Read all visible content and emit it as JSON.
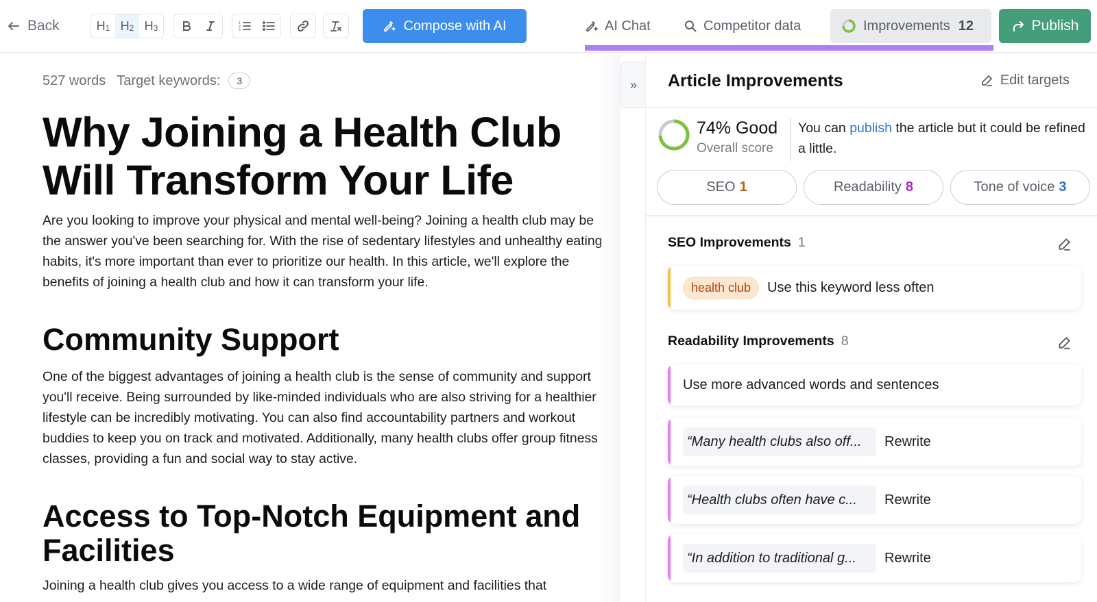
{
  "toolbar": {
    "back_label": "Back",
    "heading_buttons": [
      {
        "label": "H",
        "sub": "1",
        "active": false
      },
      {
        "label": "H",
        "sub": "2",
        "active": true
      },
      {
        "label": "H",
        "sub": "3",
        "active": false
      }
    ],
    "format_buttons": [
      "bold-icon",
      "italic-icon"
    ],
    "list_buttons": [
      "ordered-list-icon",
      "bullet-list-icon"
    ],
    "link_button": "link-icon",
    "clear_format_button": "clear-format-icon",
    "compose_label": "Compose with AI",
    "compose_color": "#3d8def"
  },
  "tabs": {
    "ai_chat": "AI Chat",
    "competitor": "Competitor data",
    "improvements": "Improvements",
    "improvements_count": "12",
    "active_underline_color": "#b07ef2"
  },
  "publish": {
    "label": "Publish",
    "color": "#449e79"
  },
  "editor": {
    "word_count": "527 words",
    "target_keywords_label": "Target keywords:",
    "target_keywords_count": "3",
    "title": "Why Joining a Health Club Will Transform Your Life",
    "intro": "Are you looking to improve your physical and mental well-being? Joining a health club may be the answer you've been searching for. With the rise of sedentary lifestyles and unhealthy eating habits, it's more important than ever to prioritize our health. In this article, we'll explore the benefits of joining a health club and how it can transform your life.",
    "sections": [
      {
        "heading": "Community Support",
        "body": "One of the biggest advantages of joining a health club is the sense of community and support you'll receive. Being surrounded by like-minded individuals who are also striving for a healthier lifestyle can be incredibly motivating. You can also find accountability partners and workout buddies to keep you on track and motivated. Additionally, many health clubs offer group fitness classes, providing a fun and social way to stay active."
      },
      {
        "heading": "Access to Top-Notch Equipment and Facilities",
        "body": "Joining a health club gives you access to a wide range of equipment and facilities that"
      }
    ]
  },
  "panel": {
    "collapse_glyph": "»",
    "title": "Article Improvements",
    "edit_targets_label": "Edit targets",
    "score": {
      "percent": 74,
      "percent_label": "74% Good",
      "label": "Overall score",
      "ring_color": "#7cc241",
      "ring_track_color": "#c9ccd3"
    },
    "message_before": "You can ",
    "message_link": "publish",
    "message_after": " the article but it could be refined a little.",
    "chips": [
      {
        "label": "SEO",
        "count": "1",
        "color": "#b2621a"
      },
      {
        "label": "Readability",
        "count": "8",
        "color": "#a52bb8"
      },
      {
        "label": "Tone of voice",
        "count": "3",
        "color": "#2d6fd1"
      }
    ],
    "seo": {
      "title": "SEO Improvements",
      "count": "1",
      "items": [
        {
          "keyword": "health club",
          "text": "Use this keyword less often"
        }
      ]
    },
    "readability": {
      "title": "Readability Improvements",
      "count": "8",
      "general": "Use more advanced words and sentences",
      "items": [
        {
          "quote": "“Many health clubs also off...",
          "action": "Rewrite"
        },
        {
          "quote": "“Health clubs often have c...",
          "action": "Rewrite"
        },
        {
          "quote": "“In addition to traditional g...",
          "action": "Rewrite"
        }
      ]
    }
  }
}
